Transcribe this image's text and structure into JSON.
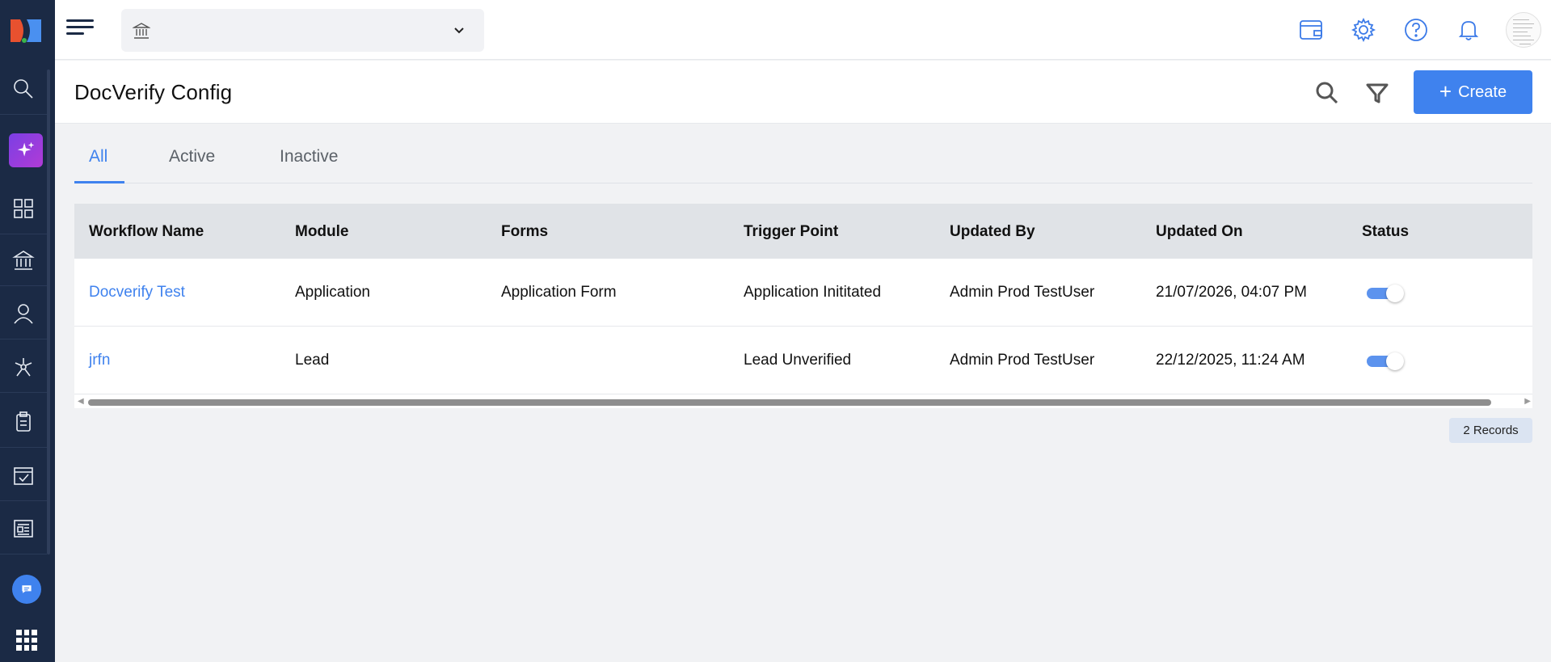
{
  "header": {
    "org_selector_value": ""
  },
  "page": {
    "title": "DocVerify Config",
    "create_label": "Create"
  },
  "tabs": [
    {
      "label": "All",
      "active": true
    },
    {
      "label": "Active",
      "active": false
    },
    {
      "label": "Inactive",
      "active": false
    }
  ],
  "table": {
    "columns": [
      "Workflow Name",
      "Module",
      "Forms",
      "Trigger Point",
      "Updated By",
      "Updated On",
      "Status"
    ],
    "rows": [
      {
        "workflow_name": "Docverify Test",
        "module": "Application",
        "forms": "Application Form",
        "trigger_point": "Application Inititated",
        "updated_by": "Admin Prod TestUser",
        "updated_on": "21/07/2026, 04:07 PM",
        "status_on": true
      },
      {
        "workflow_name": "jrfn",
        "module": "Lead",
        "forms": "",
        "trigger_point": "Lead Unverified",
        "updated_by": "Admin Prod TestUser",
        "updated_on": "22/12/2025, 11:24 AM",
        "status_on": true
      }
    ]
  },
  "footer": {
    "records_label": "2 Records"
  },
  "colors": {
    "sidebar_bg": "#1b2a45",
    "accent": "#3f82ee",
    "header_row_bg": "#e0e3e7",
    "page_bg": "#f1f2f4"
  },
  "icons": {
    "sidebar": [
      "search-icon",
      "ai-sparkle-icon",
      "dashboard-icon",
      "bank-icon",
      "user-icon",
      "workflow-icon",
      "clipboard-icon",
      "calendar-check-icon",
      "newspaper-icon",
      "chat-icon",
      "apps-grid-icon"
    ],
    "topbar": [
      "menu-icon",
      "bank-icon",
      "chevron-down-icon",
      "wallet-icon",
      "settings-icon",
      "help-icon",
      "bell-icon",
      "avatar"
    ]
  }
}
